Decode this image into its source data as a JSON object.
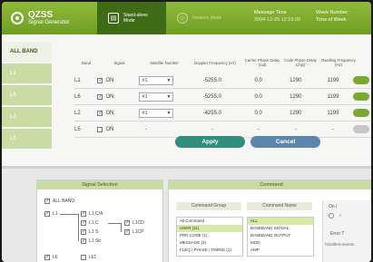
{
  "app": {
    "title": "QZSS",
    "subtitle": "Signal Generator"
  },
  "modes": [
    {
      "label": "Stand-alone Mode",
      "active": true,
      "icon": "standalone-mode-icon"
    },
    {
      "label": "Network Mode",
      "active": false,
      "icon": "network-mode-icon"
    }
  ],
  "header_info": {
    "message_time_label": "Message Time",
    "message_time_value": "2004-12-25 12:19:00",
    "week_label": "Week Number :",
    "time_of_week_label": "Time of Week :"
  },
  "bands": [
    {
      "label": "ALL BAND",
      "active": true
    },
    {
      "label": "L1",
      "active": false
    },
    {
      "label": "L6",
      "active": false
    },
    {
      "label": "L2",
      "active": false
    },
    {
      "label": "L5",
      "active": false
    }
  ],
  "signal_table": {
    "headers": {
      "band": "Band",
      "signal": "Signal",
      "prn": "Satellite Number",
      "doppler": "Doppler Frequency (Hz)",
      "carrier": "Carrier Phase Delay (rad)",
      "code": "Code Phase Delay (chip)",
      "dwelling": "Dwelling Frequency (Hz)"
    },
    "rows": [
      {
        "band": "L1",
        "checked": true,
        "signal": "ON",
        "prn": "#1",
        "doppler": "-5255.0",
        "carrier": "0.0",
        "code": "1290",
        "dwell": "1199",
        "enabled": true
      },
      {
        "band": "L6",
        "checked": true,
        "signal": "ON",
        "prn": "#1",
        "doppler": "-5255.0",
        "carrier": "0.0",
        "code": "1290",
        "dwell": "1199",
        "enabled": true
      },
      {
        "band": "L2",
        "checked": true,
        "signal": "ON",
        "prn": "#1",
        "doppler": "-4255.0",
        "carrier": "0.0",
        "code": "1290",
        "dwell": "1199",
        "enabled": true
      },
      {
        "band": "L5",
        "checked": false,
        "signal": "ON",
        "prn": "-",
        "doppler": "-",
        "carrier": "-",
        "code": "-",
        "dwell": "-",
        "enabled": false
      }
    ]
  },
  "buttons": {
    "apply": "Apply",
    "cancel": "Cancel"
  },
  "signal_selection": {
    "title": "Signal Selection",
    "all_band": "ALL BAND",
    "l1": "L1",
    "l1_children": [
      "L1 C/A",
      "L1 C",
      "L1 S",
      "L1 Sb"
    ],
    "l1c_children": [
      "L1CD",
      "L1CP"
    ],
    "l6": "L6",
    "l61": "L61"
  },
  "command": {
    "title": "Command",
    "group_label": "Command Group",
    "name_label": "Command Name",
    "on_label": "On /",
    "error_label": "Error T",
    "error_value": "hrizaftenoments",
    "groups": [
      "All Command",
      "USER (11)",
      "PRN CODE (1)",
      "MESSAGE (3)",
      "FLEQ / PHASE / TIMING (1)"
    ],
    "selected_group": 1,
    "names": [
      "ALL",
      "BASEBAND SIGNAL",
      "BASEBAND OUTPUT",
      "MOD",
      "AMP"
    ],
    "selected_name": 0
  }
}
